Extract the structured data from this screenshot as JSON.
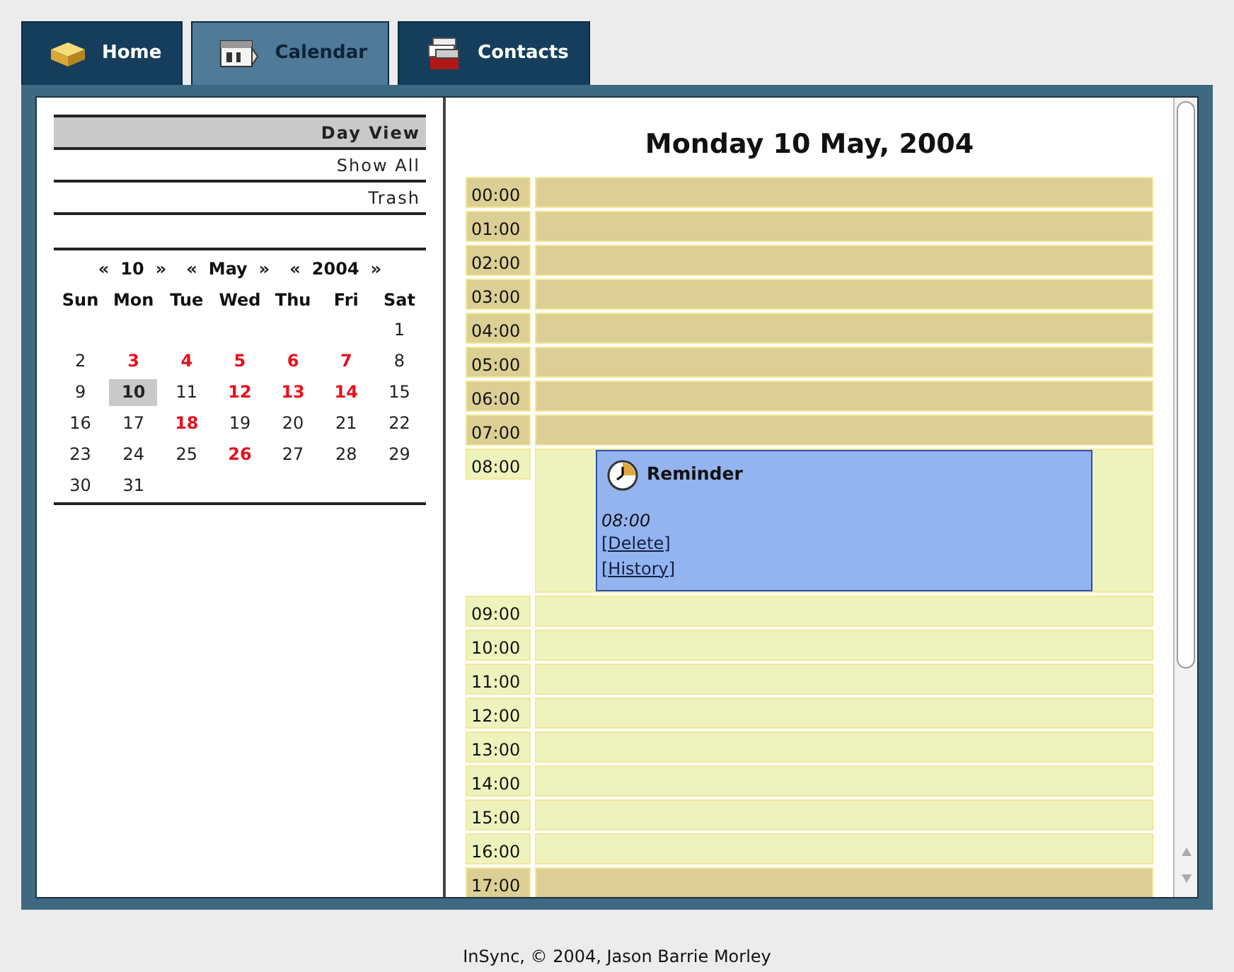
{
  "tabs": [
    {
      "label": "Home",
      "selected": false
    },
    {
      "label": "Calendar",
      "selected": true
    },
    {
      "label": "Contacts",
      "selected": false
    }
  ],
  "menu": [
    {
      "label": "Day View",
      "selected": true
    },
    {
      "label": "Show All",
      "selected": false
    },
    {
      "label": "Trash",
      "selected": false
    }
  ],
  "month_nav": [
    {
      "prev": "«",
      "value": "10",
      "next": "»"
    },
    {
      "prev": "«",
      "value": "May",
      "next": "»"
    },
    {
      "prev": "«",
      "value": "2004",
      "next": "»"
    }
  ],
  "weekdays": [
    "Sun",
    "Mon",
    "Tue",
    "Wed",
    "Thu",
    "Fri",
    "Sat"
  ],
  "weeks": [
    {
      "align_right": true,
      "days": [
        {
          "day": "1",
          "has_events": false,
          "selected": false
        }
      ]
    },
    {
      "days": [
        {
          "day": "2",
          "has_events": false,
          "selected": false
        },
        {
          "day": "3",
          "has_events": true,
          "selected": false
        },
        {
          "day": "4",
          "has_events": true,
          "selected": false
        },
        {
          "day": "5",
          "has_events": true,
          "selected": false
        },
        {
          "day": "6",
          "has_events": true,
          "selected": false
        },
        {
          "day": "7",
          "has_events": true,
          "selected": false
        },
        {
          "day": "8",
          "has_events": false,
          "selected": false
        }
      ]
    },
    {
      "days": [
        {
          "day": "9",
          "has_events": false,
          "selected": false
        },
        {
          "day": "10",
          "has_events": false,
          "selected": true
        },
        {
          "day": "11",
          "has_events": false,
          "selected": false
        },
        {
          "day": "12",
          "has_events": true,
          "selected": false
        },
        {
          "day": "13",
          "has_events": true,
          "selected": false
        },
        {
          "day": "14",
          "has_events": true,
          "selected": false
        },
        {
          "day": "15",
          "has_events": false,
          "selected": false
        }
      ]
    },
    {
      "days": [
        {
          "day": "16",
          "has_events": false,
          "selected": false
        },
        {
          "day": "17",
          "has_events": false,
          "selected": false
        },
        {
          "day": "18",
          "has_events": true,
          "selected": false
        },
        {
          "day": "19",
          "has_events": false,
          "selected": false
        },
        {
          "day": "20",
          "has_events": false,
          "selected": false
        },
        {
          "day": "21",
          "has_events": false,
          "selected": false
        },
        {
          "day": "22",
          "has_events": false,
          "selected": false
        }
      ]
    },
    {
      "days": [
        {
          "day": "23",
          "has_events": false,
          "selected": false
        },
        {
          "day": "24",
          "has_events": false,
          "selected": false
        },
        {
          "day": "25",
          "has_events": false,
          "selected": false
        },
        {
          "day": "26",
          "has_events": true,
          "selected": false
        },
        {
          "day": "27",
          "has_events": false,
          "selected": false
        },
        {
          "day": "28",
          "has_events": false,
          "selected": false
        },
        {
          "day": "29",
          "has_events": false,
          "selected": false
        }
      ]
    },
    {
      "align_right": false,
      "days": [
        {
          "day": "30",
          "has_events": false,
          "selected": false
        },
        {
          "day": "31",
          "has_events": false,
          "selected": false
        }
      ]
    }
  ],
  "day_view": {
    "title": "Monday 10 May, 2004",
    "hours": [
      {
        "time": "00:00",
        "working": false
      },
      {
        "time": "01:00",
        "working": false
      },
      {
        "time": "02:00",
        "working": false
      },
      {
        "time": "03:00",
        "working": false
      },
      {
        "time": "04:00",
        "working": false
      },
      {
        "time": "05:00",
        "working": false
      },
      {
        "time": "06:00",
        "working": false
      },
      {
        "time": "07:00",
        "working": false
      },
      {
        "time": "08:00",
        "working": true,
        "events": [
          {
            "title": "Reminder",
            "time": "08:00",
            "links": [
              "[Delete]",
              "[History]"
            ]
          }
        ]
      },
      {
        "time": "09:00",
        "working": true
      },
      {
        "time": "10:00",
        "working": true
      },
      {
        "time": "11:00",
        "working": true
      },
      {
        "time": "12:00",
        "working": true
      },
      {
        "time": "13:00",
        "working": true
      },
      {
        "time": "14:00",
        "working": true
      },
      {
        "time": "15:00",
        "working": true
      },
      {
        "time": "16:00",
        "working": true
      },
      {
        "time": "17:00",
        "working": false
      }
    ]
  },
  "footer": "InSync, © 2004, Jason Barrie Morley"
}
